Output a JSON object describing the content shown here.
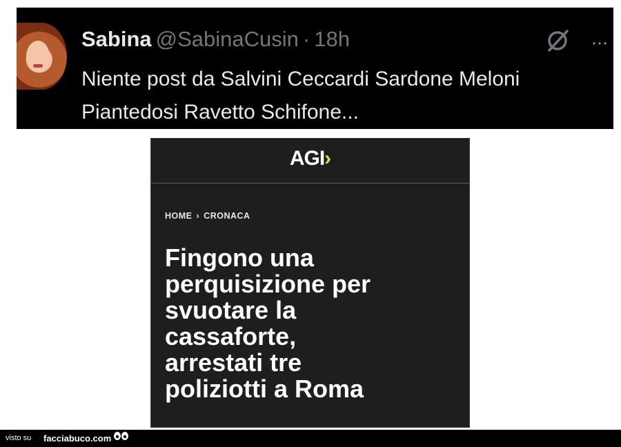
{
  "tweet": {
    "display_name": "Sabina",
    "handle": "@SabinaCusin",
    "separator": "·",
    "time": "18h",
    "text_line1": "Niente post da Salvini Ceccardi Sardone Meloni",
    "text_line2": "Piantedosi Ravetto Schifone...",
    "more_label": "···",
    "icons": [
      "avatar",
      "grok-icon",
      "more-icon"
    ]
  },
  "article": {
    "logo_text": "AGI",
    "logo_arrow": "›",
    "breadcrumb_home": "HOME",
    "breadcrumb_sep": "›",
    "breadcrumb_section": "CRONACA",
    "headline_lines": [
      "Fingono una",
      "perquisizione per",
      "svuotare la",
      "cassaforte,",
      "arrestati tre",
      "poliziotti a Roma"
    ],
    "accent_color": "#c7e83a"
  },
  "footer": {
    "visto_label": "visto su",
    "site_label": "facciabuco.com"
  }
}
